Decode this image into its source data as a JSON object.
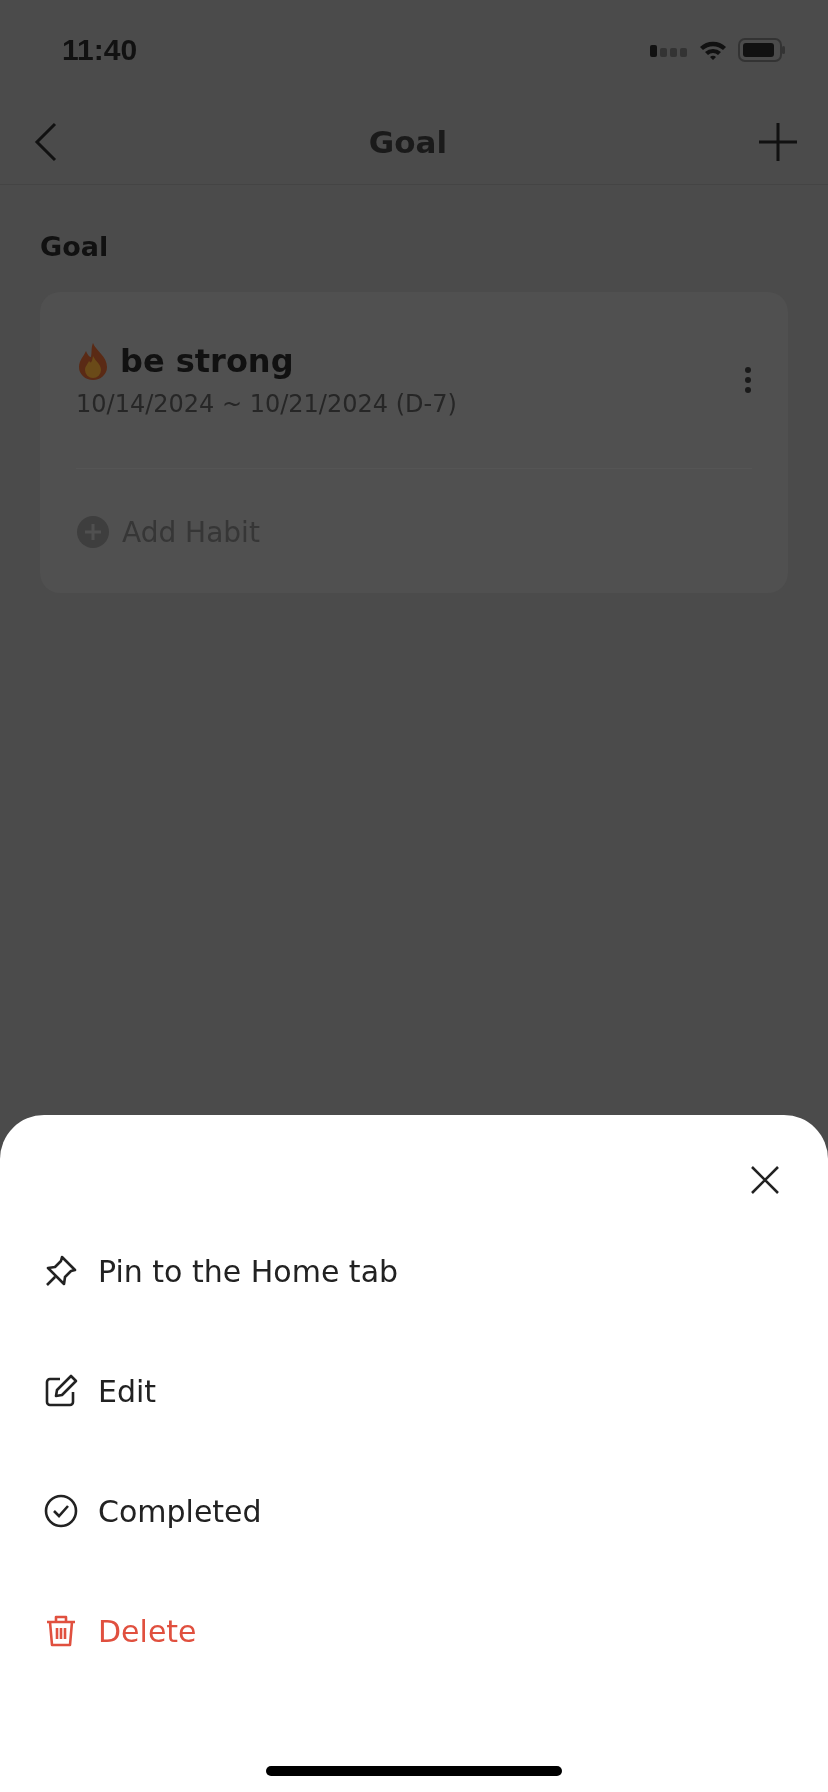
{
  "status_bar": {
    "time": "11:40"
  },
  "nav": {
    "title": "Goal"
  },
  "section_title": "Goal",
  "goal": {
    "title": "be strong",
    "dates": "10/14/2024 ~ 10/21/2024 (D-7)",
    "add_label": "Add Habit"
  },
  "sheet": {
    "items": [
      {
        "kind": "pin",
        "label": "Pin to the Home tab"
      },
      {
        "kind": "edit",
        "label": "Edit"
      },
      {
        "kind": "complete",
        "label": "Completed"
      },
      {
        "kind": "delete",
        "label": "Delete"
      }
    ]
  }
}
